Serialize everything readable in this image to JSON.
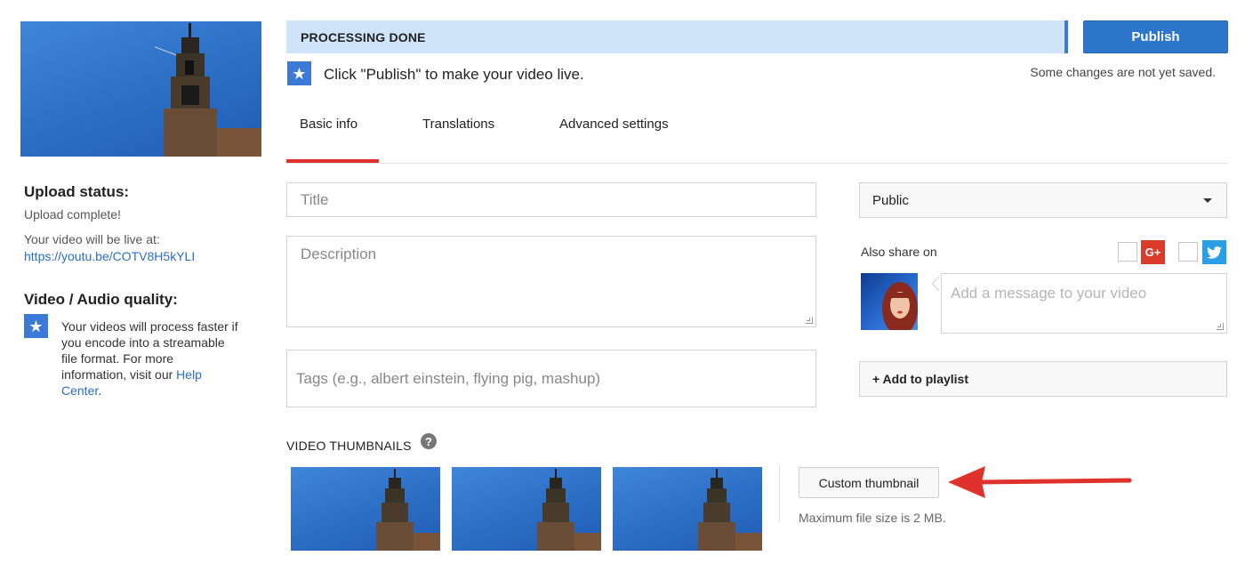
{
  "status": {
    "processing_text": "PROCESSING DONE",
    "hint": "Click \"Publish\" to make your video live.",
    "save_note": "Some changes are not yet saved."
  },
  "publish_label": "Publish",
  "tabs": [
    {
      "label": "Basic info",
      "active": true
    },
    {
      "label": "Translations",
      "active": false
    },
    {
      "label": "Advanced settings",
      "active": false
    }
  ],
  "sidebar": {
    "upload_status_title": "Upload status:",
    "upload_complete": "Upload complete!",
    "live_at_label": "Your video will be live at:",
    "video_url": "https://youtu.be/COTV8H5kYLI",
    "quality_title": "Video / Audio quality:",
    "quality_text": "Your videos will process faster if you encode into a streamable file format. For more information, visit our",
    "help_link": "Help Center",
    "help_suffix": "."
  },
  "form": {
    "title_placeholder": "Title",
    "description_placeholder": "Description",
    "tags_placeholder": "Tags (e.g., albert einstein, flying pig, mashup)"
  },
  "visibility": {
    "selected": "Public"
  },
  "share": {
    "label": "Also share on",
    "gplus_label": "G+",
    "message_placeholder": "Add a message to your video"
  },
  "playlist_label": "+ Add to playlist",
  "thumbnails": {
    "label": "VIDEO THUMBNAILS",
    "help_symbol": "?",
    "custom_button": "Custom thumbnail",
    "max_size": "Maximum file size is 2 MB."
  },
  "colors": {
    "accent_blue": "#2e75cc",
    "tab_underline": "#e0322d",
    "processing_bg": "#cfe3f9",
    "annotation_arrow": "#e0322d",
    "gplus": "#db3b2b",
    "twitter": "#2a9fe6"
  },
  "icons": {
    "star": "star-icon",
    "help": "help-icon",
    "caret": "chevron-down-icon",
    "gplus": "google-plus-icon",
    "twitter": "twitter-icon",
    "arrow": "annotation-arrow-icon"
  }
}
